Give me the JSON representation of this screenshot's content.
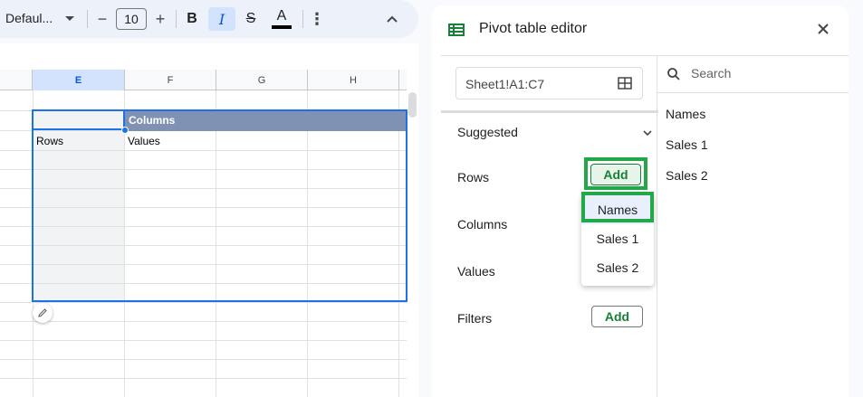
{
  "toolbar": {
    "font_name": "Defaul...",
    "font_size": "10",
    "minus": "−",
    "plus": "+",
    "bold": "B",
    "italic": "I",
    "strike": "S",
    "text_color": "A",
    "more": "⋮",
    "collapse": "⌃"
  },
  "sheet": {
    "columns": [
      "E",
      "F",
      "G",
      "H"
    ],
    "selected_column": "E",
    "header_band_label": "Columns",
    "cell_rows": "Rows",
    "cell_values": "Values",
    "header_band_color": "#7f92b3",
    "selection_color": "#1a73e8"
  },
  "pivot": {
    "title": "Pivot table editor",
    "data_range": "Sheet1!A1:C7",
    "sections": {
      "suggested": "Suggested",
      "rows": "Rows",
      "columns": "Columns",
      "values": "Values",
      "filters": "Filters"
    },
    "rows_add": "Add",
    "filters_add": "Add",
    "dropdown_items": [
      "Names",
      "Sales 1",
      "Sales 2"
    ],
    "search_placeholder": "Search",
    "fields": [
      "Names",
      "Sales 1",
      "Sales 2"
    ],
    "accent_color": "#188038",
    "highlight_color": "#22a846"
  }
}
